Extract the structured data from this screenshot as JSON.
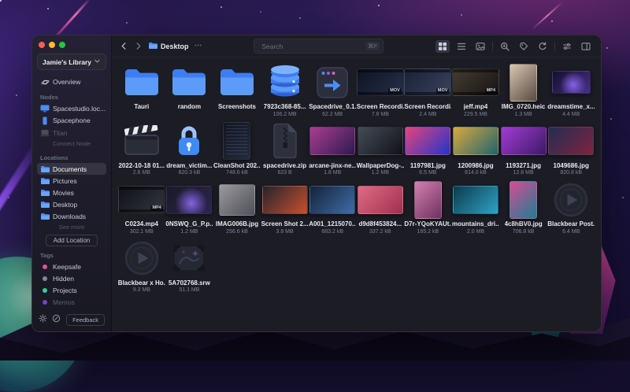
{
  "theme": {
    "accent": "#4c8df6",
    "window_bg": "#1b1c24",
    "selection_bg": "rgba(255,255,255,0.10)"
  },
  "window": {
    "traffic_lights": [
      {
        "name": "close",
        "color": "#ff5f57"
      },
      {
        "name": "minimize",
        "color": "#febc2e"
      },
      {
        "name": "zoom",
        "color": "#29c63f"
      }
    ]
  },
  "sidebar": {
    "library_label": "Jamie's Library",
    "overview_label": "Overview",
    "nodes_heading": "Nodes",
    "nodes": [
      {
        "label": "Spacestudio.loc...",
        "icon": "monitor-icon",
        "dim": false
      },
      {
        "label": "Spacephone",
        "icon": "phone-icon",
        "dim": false
      },
      {
        "label": "Titan",
        "icon": "laptop-icon",
        "dim": true
      }
    ],
    "connect_node_label": "Connect Node",
    "locations_heading": "Locations",
    "locations": [
      {
        "label": "Documents",
        "active": true
      },
      {
        "label": "Pictures",
        "active": false
      },
      {
        "label": "Movies",
        "active": false
      },
      {
        "label": "Desktop",
        "active": false
      },
      {
        "label": "Downloads",
        "active": false
      }
    ],
    "see_more_label": "See more",
    "add_location_label": "Add Location",
    "tags_heading": "Tags",
    "tags": [
      {
        "label": "Keepsafe",
        "color": "#e0509f",
        "dim": false
      },
      {
        "label": "Hidden",
        "color": "#83889a",
        "dim": false
      },
      {
        "label": "Projects",
        "color": "#2fd39a",
        "dim": false
      },
      {
        "label": "Memos",
        "color": "#6d4ac0",
        "dim": true
      }
    ],
    "footer_icons": [
      "settings-gear-icon",
      "support-icon"
    ],
    "feedback_label": "Feedback"
  },
  "toolbar": {
    "path_label": "Desktop",
    "search_placeholder": "Search",
    "search_shortcut": "⌘F",
    "tools": [
      {
        "name": "grid-view-icon",
        "active": true
      },
      {
        "name": "list-view-icon",
        "active": false
      },
      {
        "name": "media-view-icon",
        "active": false
      },
      {
        "sep": true
      },
      {
        "name": "zoom-icon",
        "active": false
      },
      {
        "name": "tag-icon",
        "active": false
      },
      {
        "name": "refresh-icon",
        "active": false
      },
      {
        "sep": true
      },
      {
        "name": "filters-icon",
        "active": false
      },
      {
        "name": "inspector-icon",
        "active": false
      }
    ]
  },
  "grid": {
    "items": [
      {
        "name": "Tauri",
        "size": "",
        "kind": "folder"
      },
      {
        "name": "random",
        "size": "",
        "kind": "folder"
      },
      {
        "name": "Screenshots",
        "size": "",
        "kind": "folder"
      },
      {
        "name": "7923c368-85...",
        "size": "106.2 MB",
        "kind": "database"
      },
      {
        "name": "Spacedrive_0.1...",
        "size": "62.2 MB",
        "kind": "installer"
      },
      {
        "name": "Screen Recordi...",
        "size": "7.8 MB",
        "kind": "video",
        "badge": "MOV",
        "colors": [
          "#0e1320",
          "#27304a"
        ]
      },
      {
        "name": "Screen Recordi...",
        "size": "2.4 MB",
        "kind": "video",
        "badge": "MOV",
        "colors": [
          "#1a2133",
          "#39435f"
        ]
      },
      {
        "name": "jeff.mp4",
        "size": "229.5 MB",
        "kind": "video",
        "badge": "MP4",
        "colors": [
          "#443c33",
          "#171412"
        ]
      },
      {
        "name": "IMG_0720.heic",
        "size": "1.3 MB",
        "kind": "photo",
        "shape": "tall",
        "colors": [
          "#d9c6ae",
          "#584a44"
        ]
      },
      {
        "name": "dreamstime_x...",
        "size": "4.4 MB",
        "kind": "photo",
        "shape": "small",
        "overlay": "glow",
        "colors": [
          "#150f2b",
          "#452f8a"
        ]
      },
      {
        "name": "2022-10-18 01...",
        "size": "2.6 MB",
        "kind": "clapper"
      },
      {
        "name": "dream_victim...",
        "size": "820.3 kB",
        "kind": "lock"
      },
      {
        "name": "CleanShot 202...",
        "size": "748.6 kB",
        "kind": "photo",
        "shape": "tall",
        "overlay": "code",
        "colors": [
          "#14151d",
          "#232b3d"
        ]
      },
      {
        "name": "spacedrive.zip",
        "size": "623 B",
        "kind": "zip"
      },
      {
        "name": "arcane-jinx-ne...",
        "size": "1.8 MB",
        "kind": "photo",
        "shape": "wide",
        "colors": [
          "#aa3d8f",
          "#2e1a4e"
        ]
      },
      {
        "name": "WallpaperDog-...",
        "size": "1.2 MB",
        "kind": "photo",
        "shape": "wide",
        "colors": [
          "#454b57",
          "#101218"
        ]
      },
      {
        "name": "1197981.jpg",
        "size": "6.5 MB",
        "kind": "photo",
        "shape": "wide",
        "colors": [
          "#e4447c",
          "#2236c9"
        ]
      },
      {
        "name": "1200986.jpg",
        "size": "814.0 kB",
        "kind": "photo",
        "shape": "wide",
        "colors": [
          "#d8a83e",
          "#20656e"
        ]
      },
      {
        "name": "1193271.jpg",
        "size": "12.8 MB",
        "kind": "photo",
        "shape": "wide",
        "colors": [
          "#a43bd4",
          "#3c1a66"
        ]
      },
      {
        "name": "1049686.jpg",
        "size": "820.8 kB",
        "kind": "photo",
        "shape": "wide",
        "colors": [
          "#222e52",
          "#7e2340"
        ]
      },
      {
        "name": "C0234.mp4",
        "size": "302.1 MB",
        "kind": "video",
        "badge": "MP4",
        "colors": [
          "#10121a",
          "#33363f"
        ]
      },
      {
        "name": "0NSWQ_G_P.p...",
        "size": "1.2 MB",
        "kind": "photo",
        "shape": "wide",
        "overlay": "glow",
        "colors": [
          "#191a26",
          "#2d2450"
        ]
      },
      {
        "name": "IMAG006B.jpg",
        "size": "256.6 kB",
        "kind": "photo",
        "shape": "square",
        "colors": [
          "#9a9a9e",
          "#4e4f58"
        ]
      },
      {
        "name": "Screen Shot 2...",
        "size": "3.8 MB",
        "kind": "photo",
        "shape": "wide",
        "colors": [
          "#23242e",
          "#c9502e"
        ]
      },
      {
        "name": "A001_1215070...",
        "size": "683.2 kB",
        "kind": "photo",
        "shape": "wide",
        "colors": [
          "#152238",
          "#3e6ea8"
        ]
      },
      {
        "name": "d9d8f453824...",
        "size": "337.2 kB",
        "kind": "photo",
        "shape": "wide",
        "colors": [
          "#e06a84",
          "#a03050"
        ]
      },
      {
        "name": "D7r-YQoKYAUt...",
        "size": "165.2 kB",
        "kind": "photo",
        "shape": "tall",
        "colors": [
          "#d37fb0",
          "#6e3260"
        ]
      },
      {
        "name": "mountains_dri...",
        "size": "2.0 MB",
        "kind": "photo",
        "shape": "wide",
        "colors": [
          "#0c3a4c",
          "#2fa3c4"
        ]
      },
      {
        "name": "4c8hBV0.jpg",
        "size": "706.8 kB",
        "kind": "photo",
        "shape": "tall",
        "colors": [
          "#d84b96",
          "#1b7f93"
        ]
      },
      {
        "name": "Blackbear Post...",
        "size": "6.4 MB",
        "kind": "audio"
      },
      {
        "name": "Blackbear x Ho...",
        "size": "9.3 MB",
        "kind": "audio"
      },
      {
        "name": "5A702768.srw",
        "size": "51.1 MB",
        "kind": "raw"
      }
    ]
  }
}
